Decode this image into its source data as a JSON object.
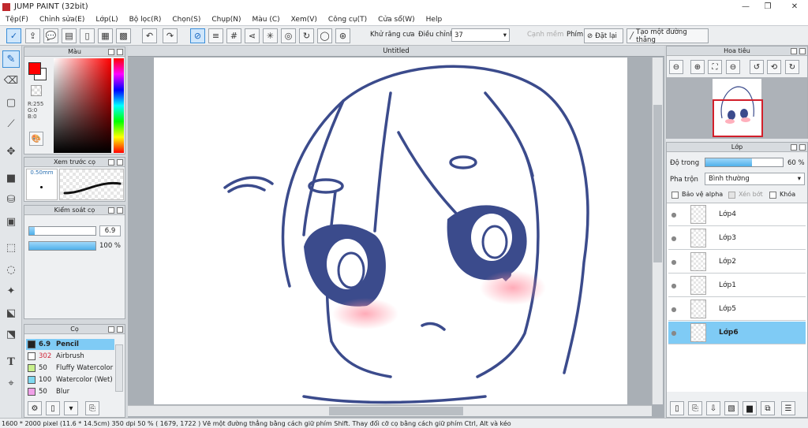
{
  "window": {
    "title": "JUMP PAINT (32bit)",
    "minimize": "—",
    "maximize": "❐",
    "close": "✕"
  },
  "menu": [
    "Tệp(F)",
    "Chỉnh sửa(E)",
    "Lớp(L)",
    "Bộ lọc(R)",
    "Chọn(S)",
    "Chụp(N)",
    "Màu (C)",
    "Xem(V)",
    "Công cụ(T)",
    "Cửa sổ(W)",
    "Help"
  ],
  "toolbar": {
    "antialias_label": "Khử răng cưa",
    "adjust_label": "Điều chỉnh",
    "adjust_value": "37",
    "edge_label": "Cạnh mềm",
    "key_label": "Phím",
    "reset_label": "Đặt lại",
    "straight_line_label": "Tạo một đường thẳng"
  },
  "color_panel": {
    "title": "Màu",
    "r": "R:255",
    "g": "G:0",
    "b": "B:0",
    "primary": "#ff0000",
    "secondary": "#ffffff"
  },
  "preview_panel": {
    "title": "Xem trước cọ",
    "size": "0.50mm"
  },
  "control_panel": {
    "title": "Kiểm soát cọ",
    "size_value": "6.9",
    "opacity_value": "100 %",
    "size_fraction": 0.08,
    "opacity_fraction": 1.0
  },
  "brush_panel": {
    "title": "Cọ",
    "brushes": [
      {
        "size": "6.9",
        "name": "Pencil",
        "color": "#222222",
        "selected": true
      },
      {
        "size": "302",
        "name": "Airbrush",
        "color": "#ffffff",
        "selected": false
      },
      {
        "size": "50",
        "name": "Fluffy Watercolor",
        "color": "#c8f08c",
        "selected": false
      },
      {
        "size": "100",
        "name": "Watercolor (Wet)",
        "color": "#7fd8f0",
        "selected": false
      },
      {
        "size": "50",
        "name": "Blur",
        "color": "#f0a0e8",
        "selected": false
      }
    ]
  },
  "document": {
    "tab": "Untitled"
  },
  "navigator": {
    "title": "Hoa tiêu"
  },
  "layer_panel": {
    "title": "Lớp",
    "opacity_label": "Độ trong",
    "opacity_value": "60 %",
    "opacity_fraction": 0.6,
    "blend_label": "Pha trộn",
    "blend_value": "Bình thường",
    "protect_alpha": "Bảo vệ alpha",
    "clip": "Xén bớt",
    "lock": "Khóa",
    "layers": [
      {
        "name": "Lớp4",
        "selected": false
      },
      {
        "name": "Lớp3",
        "selected": false
      },
      {
        "name": "Lớp2",
        "selected": false
      },
      {
        "name": "Lớp1",
        "selected": false
      },
      {
        "name": "Lớp5",
        "selected": false
      },
      {
        "name": "Lớp6",
        "selected": true
      }
    ]
  },
  "status": "1600 * 2000 pixel   (11.6 * 14.5cm)   350 dpi   50 %   ( 1679, 1722 )   Vẽ một đường thẳng bằng cách giữ phím Shift. Thay đổi cỡ cọ bằng cách giữ phím Ctrl, Alt và kéo"
}
